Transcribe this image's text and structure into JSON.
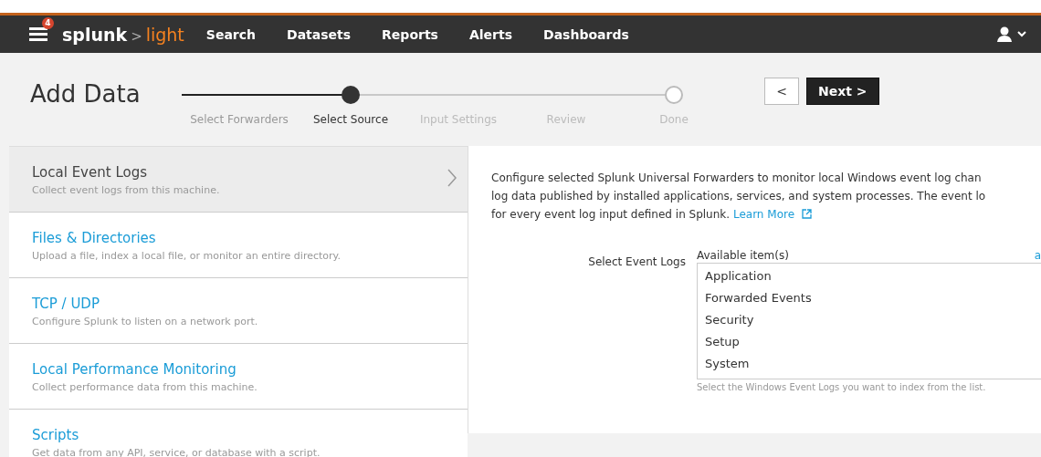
{
  "header": {
    "notification_count": "4",
    "brand": "splunk",
    "brand_separator": ">",
    "product": "light",
    "nav": [
      {
        "label": "Search"
      },
      {
        "label": "Datasets"
      },
      {
        "label": "Reports"
      },
      {
        "label": "Alerts"
      },
      {
        "label": "Dashboards"
      }
    ]
  },
  "page": {
    "title": "Add Data",
    "steps": [
      {
        "label": "Select Forwarders",
        "completed": true,
        "selected": false
      },
      {
        "label": "Select Source",
        "completed": false,
        "selected": true
      },
      {
        "label": "Input Settings",
        "completed": false,
        "selected": false
      },
      {
        "label": "Review",
        "completed": false,
        "selected": false
      },
      {
        "label": "Done",
        "completed": false,
        "selected": false
      }
    ],
    "back_button": "<",
    "next_button": "Next >"
  },
  "sources": [
    {
      "title": "Local Event Logs",
      "description": "Collect event logs from this machine.",
      "selected": true
    },
    {
      "title": "Files & Directories",
      "description": "Upload a file, index a local file, or monitor an entire directory.",
      "selected": false
    },
    {
      "title": "TCP / UDP",
      "description": "Configure Splunk to listen on a network port.",
      "selected": false
    },
    {
      "title": "Local Performance Monitoring",
      "description": "Collect performance data from this machine.",
      "selected": false
    },
    {
      "title": "Scripts",
      "description": "Get data from any API, service, or database with a script.",
      "selected": false
    }
  ],
  "detail": {
    "description_lines": [
      "Configure selected Splunk Universal Forwarders to monitor local Windows event log chan",
      "log data published by installed applications, services, and system processes. The event lo",
      "for every event log input defined in Splunk."
    ],
    "learn_more": "Learn More",
    "field_label": "Select Event Logs",
    "available_label": "Available item(s)",
    "add_all_link": "a",
    "items": [
      "Application",
      "Forwarded Events",
      "Security",
      "Setup",
      "System"
    ],
    "help": "Select the Windows Event Logs you want to index from the list."
  }
}
